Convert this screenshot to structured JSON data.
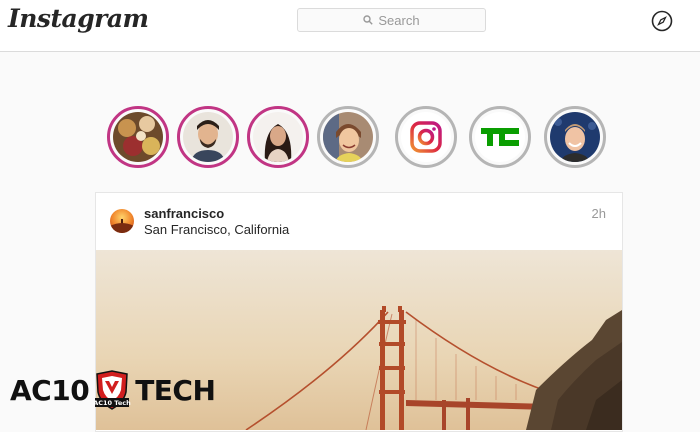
{
  "header": {
    "logo": "Instagram",
    "search_placeholder": "Search",
    "icons": {
      "search": "search-icon",
      "explore": "compass-icon"
    }
  },
  "stories": [
    {
      "name": "story-1",
      "ring": "gradient"
    },
    {
      "name": "story-2",
      "ring": "gradient"
    },
    {
      "name": "story-3",
      "ring": "gradient"
    },
    {
      "name": "story-4",
      "ring": "seen"
    },
    {
      "name": "story-instagram",
      "ring": "seen"
    },
    {
      "name": "story-techcrunch",
      "ring": "seen"
    },
    {
      "name": "story-7",
      "ring": "seen"
    }
  ],
  "post": {
    "username": "sanfrancisco",
    "location": "San Francisco, California",
    "time": "2h"
  },
  "watermark": {
    "left": "AC10",
    "badge": "AC10 Tech",
    "right": "TECH"
  },
  "colors": {
    "accent_gradient": [
      "#f09433",
      "#dc2743",
      "#bc1888"
    ],
    "techcrunch_green": "#0a9e01",
    "border": "#dbdbdb"
  }
}
